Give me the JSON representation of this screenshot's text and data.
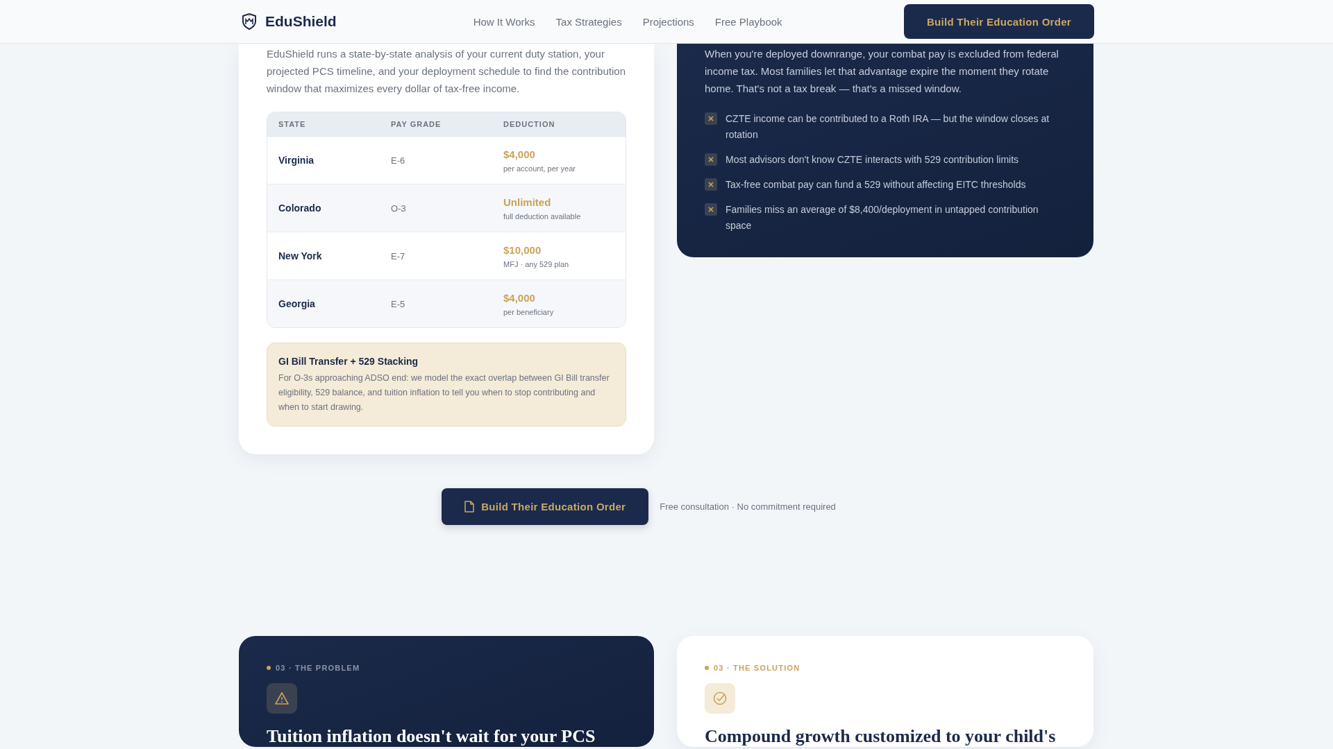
{
  "header": {
    "brand": "EduShield",
    "nav": [
      "How It Works",
      "Tax Strategies",
      "Projections",
      "Free Playbook"
    ],
    "cta": "Build Their Education Order"
  },
  "analysis_card": {
    "intro": "EduShield runs a state-by-state analysis of your current duty station, your projected PCS timeline, and your deployment schedule to find the contribution window that maximizes every dollar of tax-free income.",
    "table": {
      "columns": [
        "STATE",
        "PAY GRADE",
        "DEDUCTION"
      ],
      "rows": [
        {
          "state": "Virginia",
          "pay_grade": "E-6",
          "deduction": "$4,000",
          "note": "per account, per year"
        },
        {
          "state": "Colorado",
          "pay_grade": "O-3",
          "deduction": "Unlimited",
          "note": "full deduction available"
        },
        {
          "state": "New York",
          "pay_grade": "E-7",
          "deduction": "$10,000",
          "note": "MFJ · any 529 plan"
        },
        {
          "state": "Georgia",
          "pay_grade": "E-5",
          "deduction": "$4,000",
          "note": "per beneficiary"
        }
      ]
    },
    "callout": {
      "title": "GI Bill Transfer + 529 Stacking",
      "text": "For O-3s approaching ADSO end: we model the exact overlap between GI Bill transfer eligibility, 529 balance, and tuition inflation to tell you when to stop contributing and when to start drawing."
    }
  },
  "combat_card": {
    "intro": "When you're deployed downrange, your combat pay is excluded from federal income tax. Most families let that advantage expire the moment they rotate home. That's not a tax break — that's a missed window.",
    "points": [
      "CZTE income can be contributed to a Roth IRA — but the window closes at rotation",
      "Most advisors don't know CZTE interacts with 529 contribution limits",
      "Tax-free combat pay can fund a 529 without affecting EITC thresholds",
      "Families miss an average of $8,400/deployment in untapped contribution space"
    ]
  },
  "cta_row": {
    "button": "Build Their Education Order",
    "note": "Free consultation · No commitment required"
  },
  "section_cards": [
    {
      "kind": "problem",
      "label": "03 · THE PROBLEM",
      "heading": "Tuition inflation doesn't wait for your PCS"
    },
    {
      "kind": "solution",
      "label": "03 · THE SOLUTION",
      "heading": "Compound growth customized to your child's"
    }
  ]
}
